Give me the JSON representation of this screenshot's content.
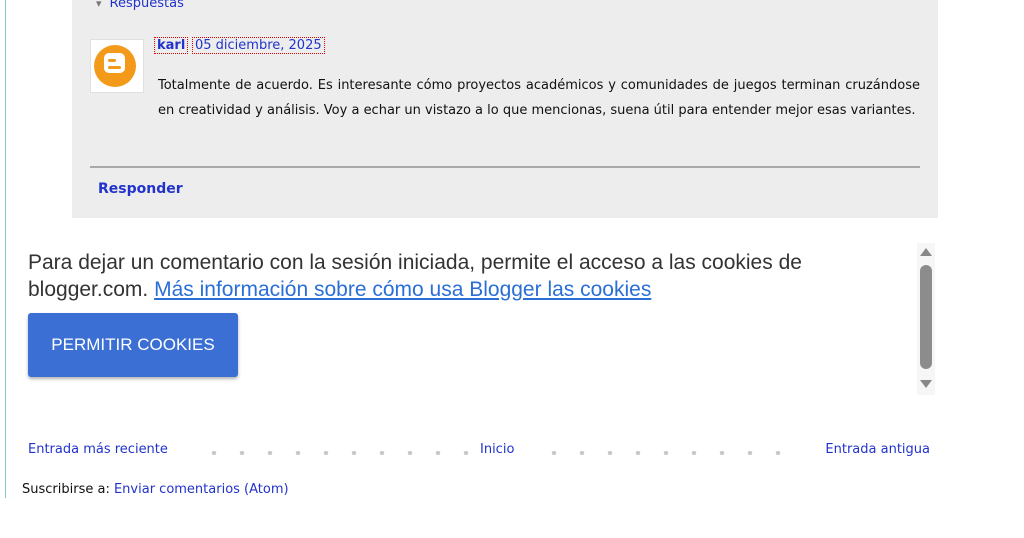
{
  "replies": {
    "toggle_label": "Respuestas"
  },
  "comment": {
    "author": "karl",
    "date": "05 diciembre, 2025",
    "text": "Totalmente de acuerdo. Es interesante cómo proyectos académicos y comunidades de juegos terminan cruzándose en creatividad y análisis. Voy a echar un vistazo a lo que mencionas, suena útil para entender mejor esas variantes.",
    "avatar_icon": "blogger-icon",
    "avatar_color": "#f39a1b"
  },
  "reply_label": "Responder",
  "cookie_notice": {
    "message": "Para dejar un comentario con la sesión iniciada, permite el acceso a las cookies de blogger.com.",
    "link_text": "Más información sobre cómo usa Blogger las cookies",
    "button_label": "PERMITIR COOKIES",
    "button_color": "#3b6fd4"
  },
  "pager": {
    "newer": "Entrada más reciente",
    "home": "Inicio",
    "older": "Entrada antigua"
  },
  "subscribe": {
    "label": "Suscribirse a:",
    "link": "Enviar comentarios (Atom)"
  }
}
